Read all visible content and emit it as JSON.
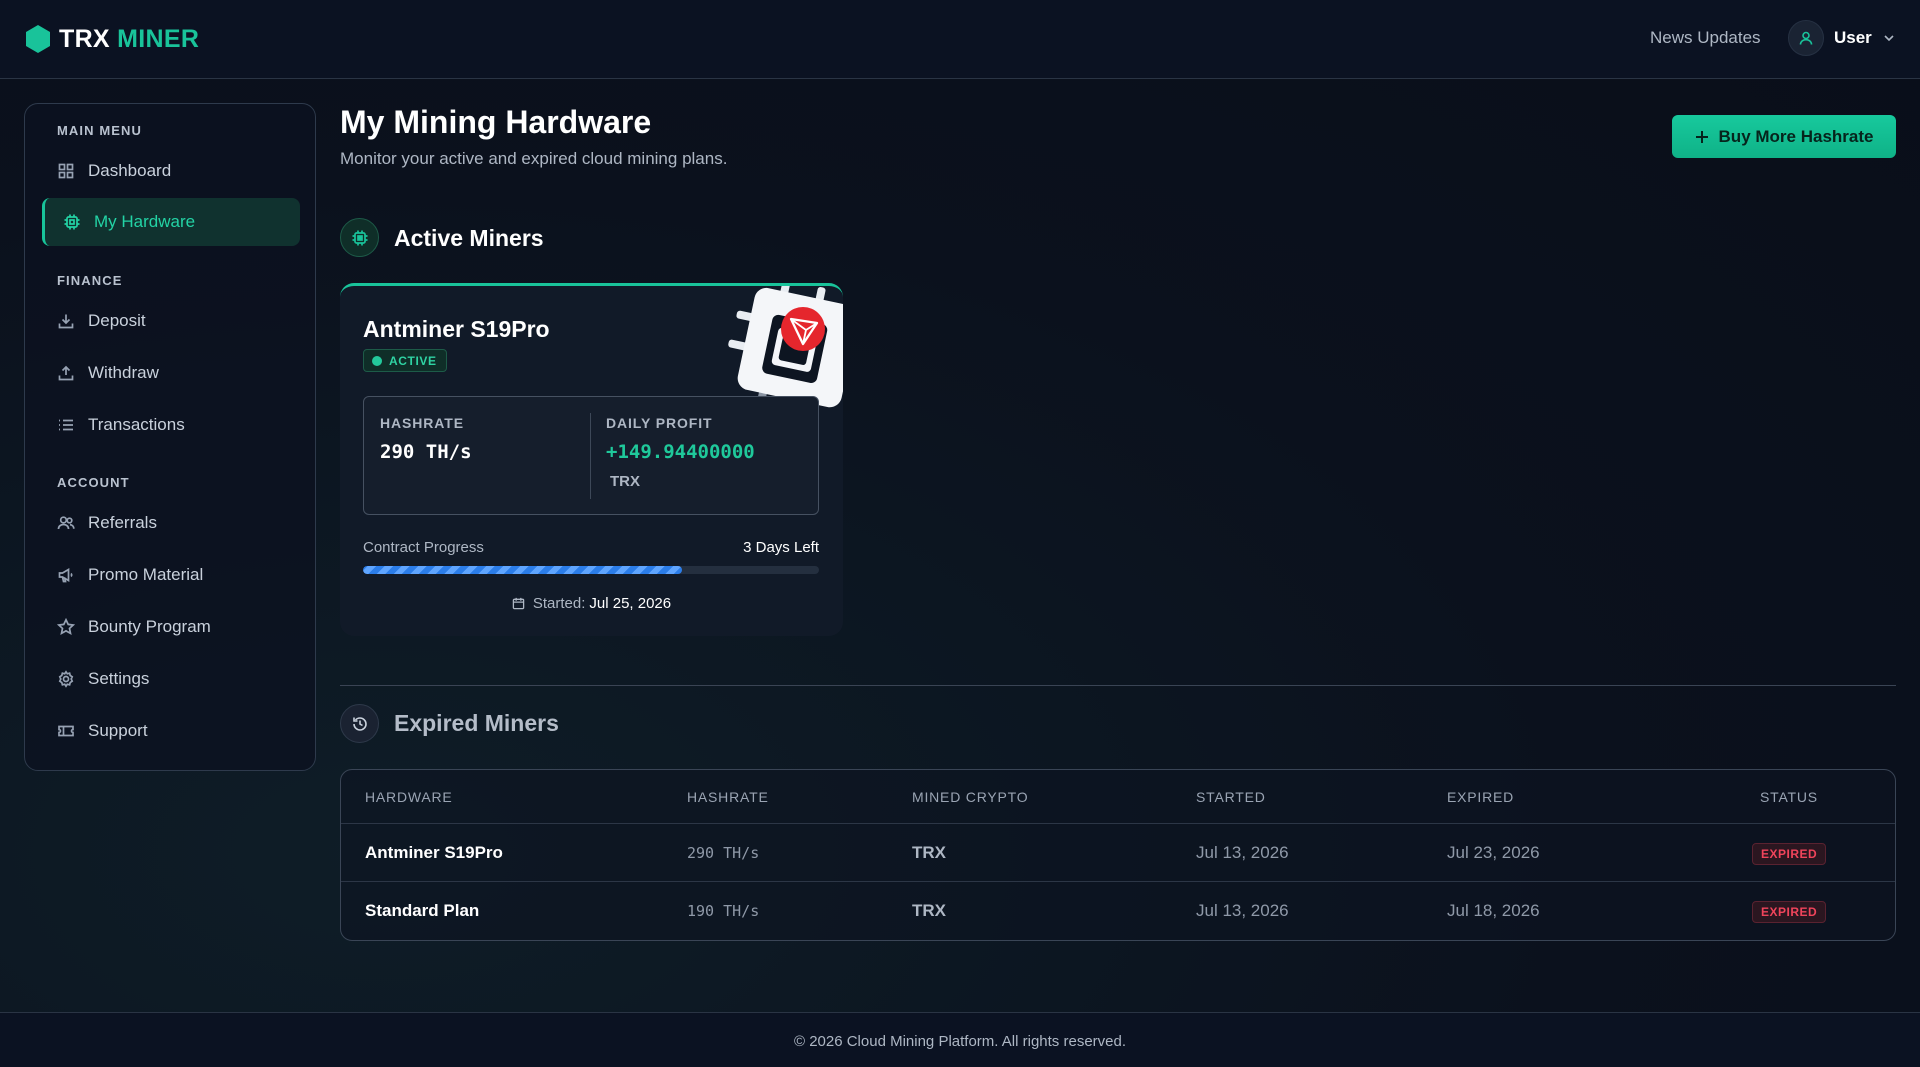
{
  "brand": {
    "part1": "TRX",
    "part2": "MINER",
    "accent": "#19c39a"
  },
  "header": {
    "news_label": "News Updates",
    "user_name": "User"
  },
  "sidebar": {
    "sections": [
      {
        "title": "MAIN MENU",
        "items": [
          {
            "label": "Dashboard",
            "icon": "grid-icon"
          },
          {
            "label": "My Hardware",
            "icon": "chip-icon",
            "active": true
          }
        ]
      },
      {
        "title": "FINANCE",
        "items": [
          {
            "label": "Deposit",
            "icon": "download-icon"
          },
          {
            "label": "Withdraw",
            "icon": "upload-icon"
          },
          {
            "label": "Transactions",
            "icon": "list-icon"
          }
        ]
      },
      {
        "title": "ACCOUNT",
        "items": [
          {
            "label": "Referrals",
            "icon": "users-icon"
          },
          {
            "label": "Promo Material",
            "icon": "megaphone-icon"
          },
          {
            "label": "Bounty Program",
            "icon": "star-icon"
          },
          {
            "label": "Settings",
            "icon": "gear-icon"
          },
          {
            "label": "Support",
            "icon": "ticket-icon"
          }
        ]
      }
    ]
  },
  "page": {
    "title": "My Mining Hardware",
    "subtitle": "Monitor your active and expired cloud mining plans.",
    "buy_button": "Buy More Hashrate"
  },
  "active": {
    "heading": "Active Miners",
    "card": {
      "name": "Antminer S19Pro",
      "status": "ACTIVE",
      "hashrate_label": "HASHRATE",
      "hashrate": "290 TH/s",
      "profit_label": "DAILY PROFIT",
      "profit": "+149.94400000",
      "profit_unit": "TRX",
      "progress_label": "Contract Progress",
      "days_left": "3 Days Left",
      "progress": 0.7,
      "started_label": "Started:",
      "started_date": "Jul 25, 2026"
    }
  },
  "expired": {
    "heading": "Expired Miners",
    "columns": [
      "HARDWARE",
      "HASHRATE",
      "MINED CRYPTO",
      "STARTED",
      "EXPIRED",
      "STATUS"
    ],
    "rows": [
      {
        "hardware": "Antminer S19Pro",
        "hashrate": "290 TH/s",
        "crypto": "TRX",
        "started": "Jul 13, 2026",
        "expired": "Jul 23, 2026",
        "status": "EXPIRED"
      },
      {
        "hardware": "Standard Plan",
        "hashrate": "190 TH/s",
        "crypto": "TRX",
        "started": "Jul 13, 2026",
        "expired": "Jul 18, 2026",
        "status": "EXPIRED"
      }
    ]
  },
  "footer": {
    "text": "© 2026 Cloud Mining Platform. All rights reserved."
  }
}
